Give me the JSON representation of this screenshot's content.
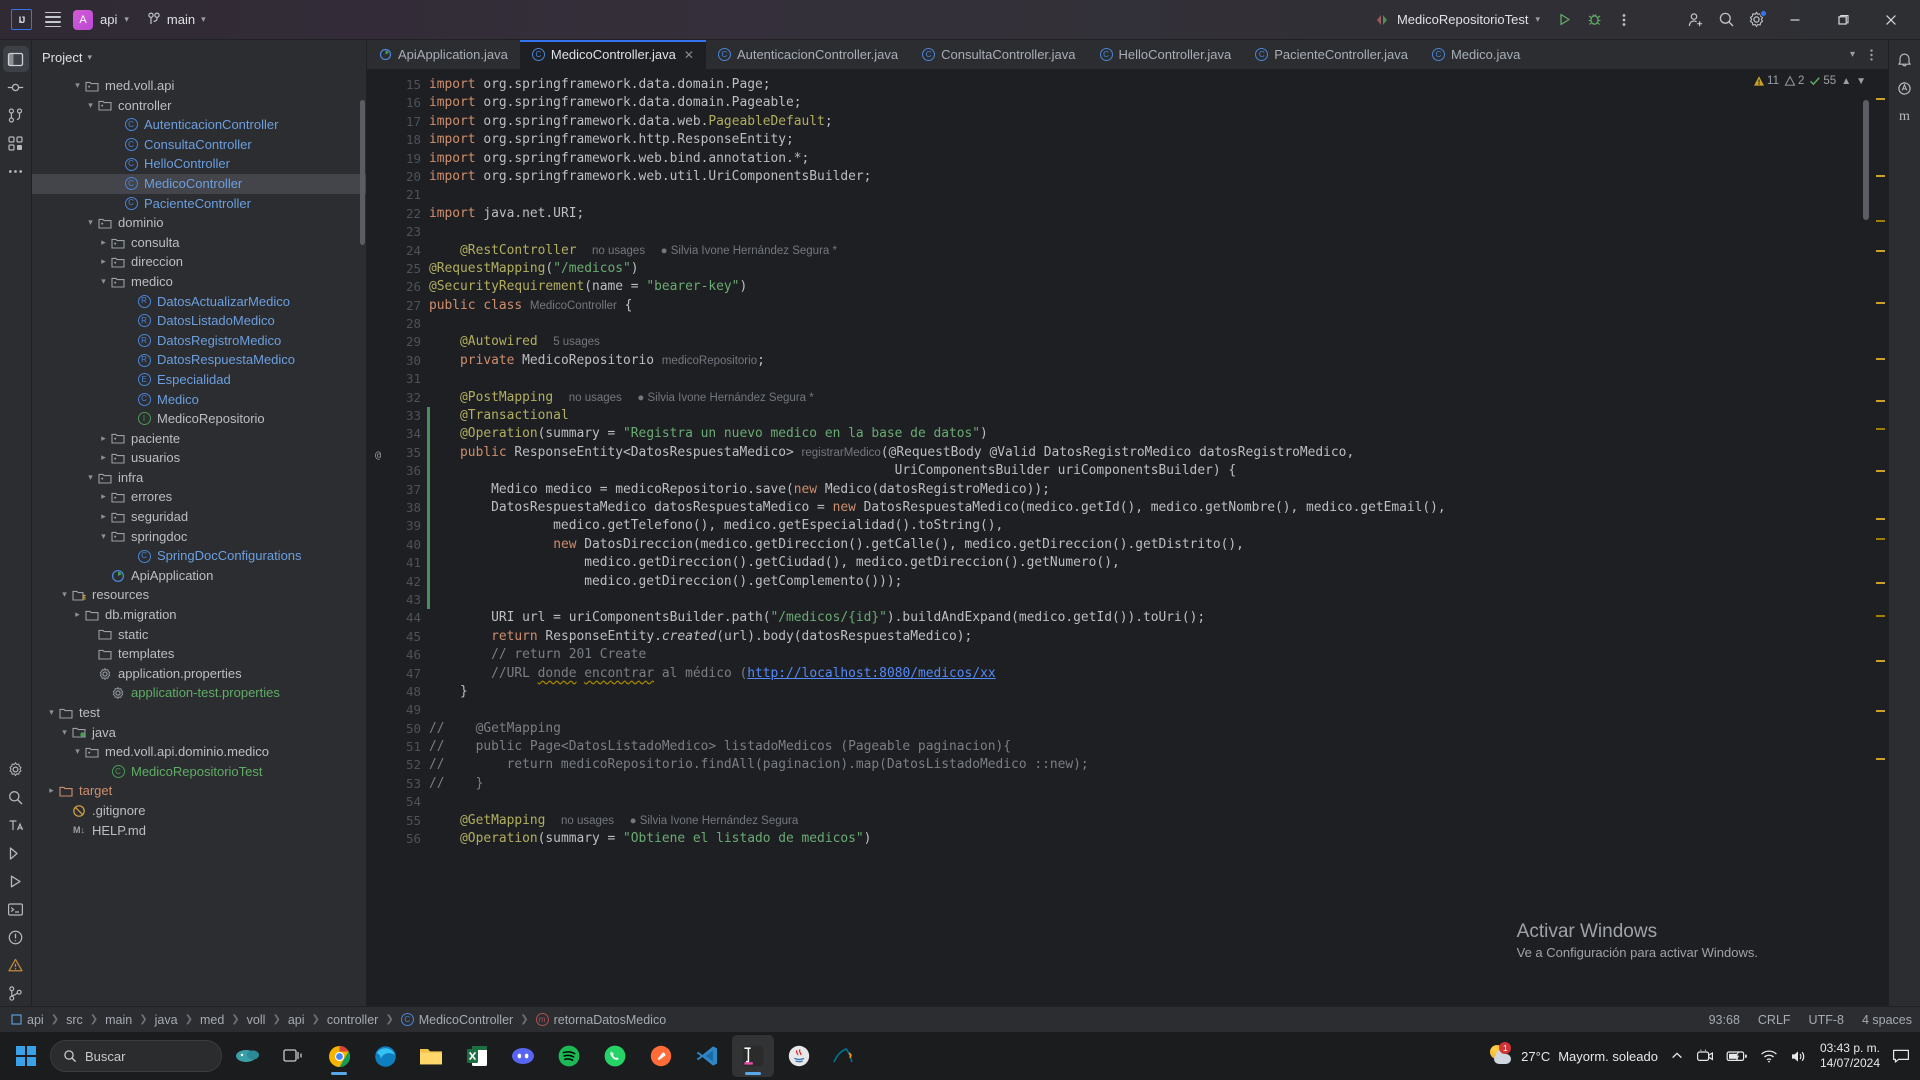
{
  "titlebar": {
    "logo_text": "IJ",
    "project_initial": "A",
    "project_name": "api",
    "branch_name": "main",
    "run_config": "MedicoRepositorioTest",
    "icons": [
      "menu-icon",
      "vcs-branch-icon",
      "run-icon",
      "debug-icon",
      "more-actions-icon",
      "add-account-icon",
      "search-icon",
      "settings-icon"
    ],
    "window_buttons": [
      "minimize",
      "maximize",
      "close"
    ]
  },
  "left_toolstrip": {
    "items": [
      "project-icon",
      "commit-icon",
      "pull-requests-icon",
      "structure-icon",
      "more-tool-windows-icon",
      "settings-icon",
      "search-everywhere-icon",
      "terminal-icon",
      "services-icon",
      "run-icon",
      "build-icon",
      "problems-icon",
      "git-icon"
    ]
  },
  "project_panel": {
    "title": "Project",
    "tree": [
      {
        "indent": 3,
        "twisty": "v",
        "icon": "package-icon",
        "label": "med.voll.api",
        "kind": "folder"
      },
      {
        "indent": 4,
        "twisty": "v",
        "icon": "package-icon",
        "label": "controller",
        "kind": "folder"
      },
      {
        "indent": 6,
        "twisty": "",
        "icon": "class-icon",
        "label": "AutenticacionController",
        "kind": "class"
      },
      {
        "indent": 6,
        "twisty": "",
        "icon": "class-icon",
        "label": "ConsultaController",
        "kind": "class"
      },
      {
        "indent": 6,
        "twisty": "",
        "icon": "class-icon",
        "label": "HelloController",
        "kind": "class"
      },
      {
        "indent": 6,
        "twisty": "",
        "icon": "class-icon",
        "label": "MedicoController",
        "kind": "class",
        "selected": true
      },
      {
        "indent": 6,
        "twisty": "",
        "icon": "class-icon",
        "label": "PacienteController",
        "kind": "class"
      },
      {
        "indent": 4,
        "twisty": "v",
        "icon": "package-icon",
        "label": "dominio",
        "kind": "folder"
      },
      {
        "indent": 5,
        "twisty": ">",
        "icon": "package-icon",
        "label": "consulta",
        "kind": "folder"
      },
      {
        "indent": 5,
        "twisty": ">",
        "icon": "package-icon",
        "label": "direccion",
        "kind": "folder"
      },
      {
        "indent": 5,
        "twisty": "v",
        "icon": "package-icon",
        "label": "medico",
        "kind": "folder"
      },
      {
        "indent": 7,
        "twisty": "",
        "icon": "record-icon",
        "label": "DatosActualizarMedico",
        "kind": "class"
      },
      {
        "indent": 7,
        "twisty": "",
        "icon": "record-icon",
        "label": "DatosListadoMedico",
        "kind": "class"
      },
      {
        "indent": 7,
        "twisty": "",
        "icon": "record-icon",
        "label": "DatosRegistroMedico",
        "kind": "class"
      },
      {
        "indent": 7,
        "twisty": "",
        "icon": "record-icon",
        "label": "DatosRespuestaMedico",
        "kind": "class"
      },
      {
        "indent": 7,
        "twisty": "",
        "icon": "enum-icon",
        "label": "Especialidad",
        "kind": "class"
      },
      {
        "indent": 7,
        "twisty": "",
        "icon": "class-icon",
        "label": "Medico",
        "kind": "class"
      },
      {
        "indent": 7,
        "twisty": "",
        "icon": "interface-icon",
        "label": "MedicoRepositorio",
        "kind": "file"
      },
      {
        "indent": 5,
        "twisty": ">",
        "icon": "package-icon",
        "label": "paciente",
        "kind": "folder"
      },
      {
        "indent": 5,
        "twisty": ">",
        "icon": "package-icon",
        "label": "usuarios",
        "kind": "folder"
      },
      {
        "indent": 4,
        "twisty": "v",
        "icon": "package-icon",
        "label": "infra",
        "kind": "folder"
      },
      {
        "indent": 5,
        "twisty": ">",
        "icon": "package-icon",
        "label": "errores",
        "kind": "folder"
      },
      {
        "indent": 5,
        "twisty": ">",
        "icon": "package-icon",
        "label": "seguridad",
        "kind": "folder"
      },
      {
        "indent": 5,
        "twisty": "v",
        "icon": "package-icon",
        "label": "springdoc",
        "kind": "folder"
      },
      {
        "indent": 7,
        "twisty": "",
        "icon": "class-icon",
        "label": "SpringDocConfigurations",
        "kind": "class"
      },
      {
        "indent": 5,
        "twisty": "",
        "icon": "spring-app-icon",
        "label": "ApiApplication",
        "kind": "file"
      },
      {
        "indent": 2,
        "twisty": "v",
        "icon": "resources-folder-icon",
        "label": "resources",
        "kind": "file"
      },
      {
        "indent": 3,
        "twisty": ">",
        "icon": "folder-icon",
        "label": "db.migration",
        "kind": "file"
      },
      {
        "indent": 4,
        "twisty": "",
        "icon": "folder-icon",
        "label": "static",
        "kind": "file"
      },
      {
        "indent": 4,
        "twisty": "",
        "icon": "folder-icon",
        "label": "templates",
        "kind": "file"
      },
      {
        "indent": 4,
        "twisty": "",
        "icon": "properties-icon",
        "label": "application.properties",
        "kind": "file"
      },
      {
        "indent": 5,
        "twisty": "",
        "icon": "properties-icon",
        "label": "application-test.properties",
        "kind": "green"
      },
      {
        "indent": 1,
        "twisty": "v",
        "icon": "folder-icon",
        "label": "test",
        "kind": "file"
      },
      {
        "indent": 2,
        "twisty": "v",
        "icon": "test-source-folder-icon",
        "label": "java",
        "kind": "file"
      },
      {
        "indent": 3,
        "twisty": "v",
        "icon": "package-icon",
        "label": "med.voll.api.dominio.medico",
        "kind": "file"
      },
      {
        "indent": 5,
        "twisty": "",
        "icon": "test-class-icon",
        "label": "MedicoRepositorioTest",
        "kind": "green"
      },
      {
        "indent": 1,
        "twisty": ">",
        "icon": "target-folder-icon",
        "label": "target",
        "kind": "orange"
      },
      {
        "indent": 2,
        "twisty": "",
        "icon": "gitignore-icon",
        "label": ".gitignore",
        "kind": "file"
      },
      {
        "indent": 2,
        "twisty": "",
        "icon": "markdown-icon",
        "label": "HELP.md",
        "kind": "file"
      }
    ]
  },
  "editor": {
    "tabs": [
      {
        "label": "ApiApplication.java",
        "icon": "spring-class-icon",
        "active": false
      },
      {
        "label": "MedicoController.java",
        "icon": "class-icon",
        "active": true,
        "closable": true
      },
      {
        "label": "AutenticacionController.java",
        "icon": "class-icon",
        "active": false
      },
      {
        "label": "ConsultaController.java",
        "icon": "class-icon",
        "active": false
      },
      {
        "label": "HelloController.java",
        "icon": "class-icon",
        "active": false
      },
      {
        "label": "PacienteController.java",
        "icon": "class-icon",
        "active": false
      },
      {
        "label": "Medico.java",
        "icon": "class-icon",
        "active": false
      }
    ],
    "inspections": {
      "warnings": "11",
      "weak_warnings": "2",
      "checks": "55",
      "warning_icon": "warning-triangle-icon",
      "weak_icon": "weak-warning-icon",
      "ok_icon": "checkmark-icon"
    },
    "first_line_number": 15,
    "lines": [
      {
        "n": 15,
        "segments": [
          {
            "t": "import org.springframework.data.domain.Page;",
            "c": "kw-import"
          }
        ]
      },
      {
        "n": 16,
        "segments": [
          {
            "t": "import org.springframework.data.domain.Pageable;",
            "c": "kw-import"
          }
        ]
      },
      {
        "n": 17,
        "segments": [
          {
            "t": "import org.springframework.data.web.PageableDefault;",
            "c": "kw-import"
          }
        ]
      },
      {
        "n": 18,
        "segments": [
          {
            "t": "import org.springframework.http.ResponseEntity;",
            "c": "kw-import"
          }
        ]
      },
      {
        "n": 19,
        "segments": [
          {
            "t": "import org.springframework.web.bind.annotation.*;",
            "c": "kw-import"
          }
        ]
      },
      {
        "n": 20,
        "segments": [
          {
            "t": "import org.springframework.web.util.UriComponentsBuilder;",
            "c": "kw-import"
          }
        ]
      },
      {
        "n": 21,
        "segments": []
      },
      {
        "n": 22,
        "segments": [
          {
            "t": "import java.net.URI;",
            "c": "kw-import"
          }
        ]
      },
      {
        "n": 23,
        "segments": []
      },
      {
        "n": 24,
        "segments": [
          {
            "t": "@RestController",
            "c": "ann"
          },
          {
            "t": "no usages",
            "c": "hint"
          },
          {
            "t": "Silvia Ivone Hernández Segura *",
            "c": "hint-author"
          }
        ]
      },
      {
        "n": 25,
        "segments": [
          {
            "t": "@RequestMapping(\"/medicos\")",
            "c": "ann-str"
          }
        ]
      },
      {
        "n": 26,
        "segments": [
          {
            "t": "@SecurityRequirement(name = \"bearer-key\")",
            "c": "ann-str"
          }
        ]
      },
      {
        "n": 27,
        "segments": [
          {
            "t": "public class MedicoController {",
            "c": "decl"
          }
        ]
      },
      {
        "n": 28,
        "segments": []
      },
      {
        "n": 29,
        "segments": [
          {
            "t": "@Autowired",
            "c": "ann"
          },
          {
            "t": "5 usages",
            "c": "hint"
          }
        ]
      },
      {
        "n": 30,
        "segments": [
          {
            "t": "private MedicoRepositorio medicoRepositorio;",
            "c": "decl"
          }
        ]
      },
      {
        "n": 31,
        "segments": []
      },
      {
        "n": 32,
        "segments": [
          {
            "t": "@PostMapping",
            "c": "ann"
          },
          {
            "t": "no usages",
            "c": "hint"
          },
          {
            "t": "Silvia Ivone Hernández Segura *",
            "c": "hint-author"
          }
        ]
      },
      {
        "n": 33,
        "segments": [
          {
            "t": "@Transactional",
            "c": "ann"
          }
        ],
        "vcs": "green"
      },
      {
        "n": 34,
        "segments": [
          {
            "t": "@Operation(summary = \"Registra un nuevo medico en la base de datos\")",
            "c": "ann-str"
          }
        ],
        "vcs": "green"
      },
      {
        "n": 35,
        "segments": [
          {
            "t": "public ResponseEntity<DatosRespuestaMedico> registrarMedico(@RequestBody @Valid DatosRegistroMedico datosRegistroMedico,",
            "c": "decl"
          }
        ],
        "marker": "@",
        "vcs": "green"
      },
      {
        "n": 36,
        "segments": [
          {
            "t": "UriComponentsBuilder uriComponentsBuilder) {",
            "c": "decl"
          }
        ],
        "vcs": "green"
      },
      {
        "n": 37,
        "segments": [
          {
            "t": "Medico medico = medicoRepositorio.save(new Medico(datosRegistroMedico));",
            "c": "body"
          }
        ],
        "vcs": "green"
      },
      {
        "n": 38,
        "segments": [
          {
            "t": "DatosRespuestaMedico datosRespuestaMedico = new DatosRespuestaMedico(medico.getId(), medico.getNombre(), medico.getEmail(),",
            "c": "body"
          }
        ],
        "vcs": "green"
      },
      {
        "n": 39,
        "segments": [
          {
            "t": "medico.getTelefono(), medico.getEspecialidad().toString(),",
            "c": "body"
          }
        ],
        "vcs": "green"
      },
      {
        "n": 40,
        "segments": [
          {
            "t": "new DatosDireccion(medico.getDireccion().getCalle(), medico.getDireccion().getDistrito(),",
            "c": "body"
          }
        ],
        "vcs": "green"
      },
      {
        "n": 41,
        "segments": [
          {
            "t": "medico.getDireccion().getCiudad(), medico.getDireccion().getNumero(),",
            "c": "body"
          }
        ],
        "vcs": "green"
      },
      {
        "n": 42,
        "segments": [
          {
            "t": "medico.getDireccion().getComplemento()));",
            "c": "body"
          }
        ],
        "vcs": "green"
      },
      {
        "n": 43,
        "segments": [],
        "vcs": "green"
      },
      {
        "n": 44,
        "segments": [
          {
            "t": "URI url = uriComponentsBuilder.path(\"/medicos/{id}\").buildAndExpand(medico.getId()).toUri();",
            "c": "body"
          }
        ]
      },
      {
        "n": 45,
        "segments": [
          {
            "t": "return ResponseEntity.created(url).body(datosRespuestaMedico);",
            "c": "body"
          }
        ]
      },
      {
        "n": 46,
        "segments": [
          {
            "t": "// return 201 Create",
            "c": "cmt"
          }
        ]
      },
      {
        "n": 47,
        "segments": [
          {
            "t": "//URL donde encontrar al médico (http://localhost:8080/medicos/xx",
            "c": "cmt-link"
          }
        ]
      },
      {
        "n": 48,
        "segments": [
          {
            "t": "}",
            "c": "body"
          }
        ]
      },
      {
        "n": 49,
        "segments": []
      },
      {
        "n": 50,
        "segments": [
          {
            "t": "//    @GetMapping",
            "c": "cmt"
          }
        ]
      },
      {
        "n": 51,
        "segments": [
          {
            "t": "//    public Page<DatosListadoMedico> listadoMedicos (Pageable paginacion){",
            "c": "cmt"
          }
        ]
      },
      {
        "n": 52,
        "segments": [
          {
            "t": "//        return medicoRepositorio.findAll(paginacion).map(DatosListadoMedico ::new);",
            "c": "cmt"
          }
        ]
      },
      {
        "n": 53,
        "segments": [
          {
            "t": "//    }",
            "c": "cmt"
          }
        ]
      },
      {
        "n": 54,
        "segments": []
      },
      {
        "n": 55,
        "segments": [
          {
            "t": "@GetMapping",
            "c": "ann"
          },
          {
            "t": "no usages",
            "c": "hint"
          },
          {
            "t": "Silvia Ivone Hernández Segura",
            "c": "hint-author"
          }
        ]
      },
      {
        "n": 56,
        "segments": [
          {
            "t": "@Operation(summary = \"Obtiene el listado de medicos\")",
            "c": "ann-str"
          }
        ]
      }
    ],
    "watermark": {
      "line1": "Activar Windows",
      "line2": "Ve a Configuración para activar Windows."
    }
  },
  "right_toolstrip": {
    "items": [
      "notifications-icon",
      "ai-assistant-icon",
      "maven-icon"
    ]
  },
  "statusbar": {
    "breadcrumbs": [
      "api",
      "src",
      "main",
      "java",
      "med",
      "voll",
      "api",
      "controller",
      "MedicoController",
      "retornaDatosMedico"
    ],
    "breadcrumb_icons": [
      "module-icon",
      "",
      "",
      "",
      "",
      "",
      "",
      "",
      "class-icon",
      "method-icon"
    ],
    "caret": "93:68",
    "line_sep": "CRLF",
    "encoding": "UTF-8",
    "indent": "4 spaces"
  },
  "taskbar": {
    "search_placeholder": "Buscar",
    "apps": [
      "windows-start-icon",
      "search-icon",
      "copilot-icon",
      "task-view-icon",
      "chrome-icon",
      "edge-icon",
      "file-explorer-icon",
      "excel-icon",
      "discord-icon",
      "spotify-icon",
      "whatsapp-icon",
      "postman-icon",
      "vscode-icon",
      "intellij-icon",
      "java-icon",
      "mysql-icon"
    ],
    "weather_temp": "27°C",
    "weather_desc": "Mayorm. soleado",
    "weather_badge": "1",
    "time": "03:43 p. m.",
    "date": "14/07/2024",
    "tray_icons": [
      "show-hidden-icons-icon",
      "camera-icon",
      "battery-icon",
      "wifi-icon",
      "volume-icon",
      "notification-center-icon"
    ]
  },
  "colors": {
    "accent_blue": "#3574f0",
    "class_blue": "#6c9fe0",
    "annotation": "#b3ae60",
    "keyword": "#cf8e6d",
    "string": "#6aab73",
    "comment": "#7a7e85",
    "bg_editor": "#1e1f22",
    "bg_panel": "#2b2d30"
  }
}
